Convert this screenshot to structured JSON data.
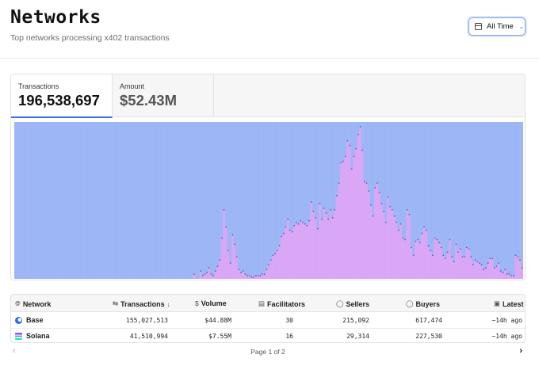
{
  "header": {
    "title": "Networks",
    "subtitle": "Top networks processing x402 transactions",
    "range_button": {
      "label": "All Time",
      "icon": "calendar-icon",
      "chevron": "chevron-down-icon"
    }
  },
  "metrics": {
    "tabs": [
      {
        "label": "Transactions",
        "value": "196,538,697",
        "active": true
      },
      {
        "label": "Amount",
        "value": "$52.43M",
        "active": false
      }
    ]
  },
  "chart_data": {
    "type": "bar",
    "stacked": true,
    "normalized": true,
    "title": "",
    "xlabel": "",
    "ylabel": "",
    "ylim": [
      0,
      1
    ],
    "colors": {
      "background_series": "#9db6f5",
      "foreground_series": "#d9a7f6",
      "dot": "#6a5ab8"
    },
    "series": [
      {
        "values": [
          0.0,
          0.0,
          0.0,
          0.0,
          0.0,
          0.0,
          0.0,
          0.0,
          0.0,
          0.0,
          0.0,
          0.0,
          0.0,
          0.0,
          0.0,
          0.0,
          0.0,
          0.0,
          0.0,
          0.0,
          0.0,
          0.0,
          0.0,
          0.0,
          0.0,
          0.0,
          0.0,
          0.0,
          0.0,
          0.0,
          0.0,
          0.0,
          0.0,
          0.0,
          0.0,
          0.0,
          0.0,
          0.0,
          0.0,
          0.0,
          0.0,
          0.0,
          0.0,
          0.0,
          0.0,
          0.0,
          0.0,
          0.0,
          0.0,
          0.0,
          0.0,
          0.0,
          0.0,
          0.0,
          0.0,
          0.0,
          0.0,
          0.0,
          0.0,
          0.0,
          0.0,
          0.0,
          0.0,
          0.0,
          0.0,
          0.0,
          0.0,
          0.0,
          0.0,
          0.0,
          0.0,
          0.0,
          0.0,
          0.0,
          0.0,
          0.0,
          0.0,
          0.0,
          0.0,
          0.0,
          0.0,
          0.0,
          0.0,
          0.0,
          0.03,
          0.0,
          0.0,
          0.05,
          0.02,
          0.03,
          0.04,
          0.07,
          0.03,
          0.02,
          0.05,
          0.08,
          0.12,
          0.26,
          0.44,
          0.33,
          0.18,
          0.1,
          0.28,
          0.22,
          0.14,
          0.06,
          0.04,
          0.05,
          0.03,
          0.02,
          0.02,
          0.01,
          0.01,
          0.02,
          0.02,
          0.02,
          0.03,
          0.03,
          0.06,
          0.09,
          0.12,
          0.15,
          0.16,
          0.18,
          0.21,
          0.27,
          0.29,
          0.33,
          0.38,
          0.31,
          0.3,
          0.34,
          0.36,
          0.35,
          0.37,
          0.36,
          0.35,
          0.34,
          0.37,
          0.49,
          0.43,
          0.39,
          0.32,
          0.48,
          0.38,
          0.45,
          0.42,
          0.38,
          0.44,
          0.39,
          0.44,
          0.53,
          0.61,
          0.74,
          0.75,
          0.78,
          0.88,
          0.85,
          0.7,
          0.78,
          0.83,
          0.92,
          0.97,
          0.82,
          0.62,
          0.61,
          0.56,
          0.47,
          0.4,
          0.58,
          0.61,
          0.55,
          0.48,
          0.43,
          0.36,
          0.52,
          0.46,
          0.44,
          0.4,
          0.36,
          0.31,
          0.35,
          0.26,
          0.25,
          0.44,
          0.41,
          0.2,
          0.15,
          0.24,
          0.25,
          0.23,
          0.29,
          0.33,
          0.31,
          0.21,
          0.18,
          0.15,
          0.26,
          0.25,
          0.23,
          0.2,
          0.15,
          0.13,
          0.17,
          0.25,
          0.14,
          0.11,
          0.22,
          0.17,
          0.19,
          0.14,
          0.14,
          0.2,
          0.19,
          0.14,
          0.09,
          0.12,
          0.11,
          0.1,
          0.09,
          0.06,
          0.07,
          0.1,
          0.13,
          0.13,
          0.07,
          0.08,
          0.1,
          0.05,
          0.04,
          0.06,
          0.03,
          0.03,
          0.02,
          0.02,
          0.15,
          0.14,
          0.12,
          0.07
        ]
      },
      {
        "values": [
          1.0,
          1.0,
          1.0,
          1.0,
          1.0,
          1.0,
          1.0,
          1.0,
          1.0,
          1.0,
          1.0,
          1.0,
          1.0,
          1.0,
          1.0,
          1.0,
          1.0,
          1.0,
          1.0,
          1.0,
          1.0,
          1.0,
          1.0,
          1.0,
          1.0,
          1.0,
          1.0,
          1.0,
          1.0,
          1.0,
          1.0,
          1.0,
          1.0,
          1.0,
          1.0,
          1.0,
          1.0,
          1.0,
          1.0,
          1.0,
          1.0,
          1.0,
          1.0,
          1.0,
          1.0,
          1.0,
          1.0,
          1.0,
          1.0,
          1.0,
          1.0,
          1.0,
          1.0,
          1.0,
          1.0,
          1.0,
          1.0,
          1.0,
          1.0,
          1.0,
          1.0,
          1.0,
          1.0,
          1.0,
          1.0,
          1.0,
          1.0,
          1.0,
          1.0,
          1.0,
          1.0,
          1.0,
          1.0,
          1.0,
          1.0,
          1.0,
          1.0,
          1.0,
          1.0,
          1.0,
          1.0,
          1.0,
          1.0,
          1.0,
          0.97,
          1.0,
          1.0,
          0.95,
          0.98,
          0.97,
          0.96,
          0.93,
          0.97,
          0.98,
          0.95,
          0.92,
          0.88,
          0.74,
          0.56,
          0.67,
          0.82,
          0.9,
          0.72,
          0.78,
          0.86,
          0.94,
          0.96,
          0.95,
          0.97,
          0.98,
          0.98,
          0.99,
          0.99,
          0.98,
          0.98,
          0.98,
          0.97,
          0.97,
          0.94,
          0.91,
          0.88,
          0.85,
          0.84,
          0.82,
          0.79,
          0.73,
          0.71,
          0.67,
          0.62,
          0.69,
          0.7,
          0.66,
          0.64,
          0.65,
          0.63,
          0.64,
          0.65,
          0.66,
          0.63,
          0.51,
          0.57,
          0.61,
          0.68,
          0.52,
          0.62,
          0.55,
          0.58,
          0.62,
          0.56,
          0.61,
          0.56,
          0.47,
          0.39,
          0.26,
          0.25,
          0.22,
          0.12,
          0.15,
          0.3,
          0.22,
          0.17,
          0.08,
          0.03,
          0.18,
          0.38,
          0.39,
          0.44,
          0.53,
          0.6,
          0.42,
          0.39,
          0.45,
          0.52,
          0.57,
          0.64,
          0.48,
          0.54,
          0.56,
          0.6,
          0.64,
          0.69,
          0.65,
          0.74,
          0.75,
          0.56,
          0.59,
          0.8,
          0.85,
          0.76,
          0.75,
          0.77,
          0.71,
          0.67,
          0.69,
          0.79,
          0.82,
          0.85,
          0.74,
          0.75,
          0.77,
          0.8,
          0.85,
          0.87,
          0.83,
          0.75,
          0.86,
          0.89,
          0.78,
          0.83,
          0.81,
          0.86,
          0.86,
          0.8,
          0.81,
          0.86,
          0.91,
          0.88,
          0.89,
          0.9,
          0.91,
          0.94,
          0.93,
          0.9,
          0.87,
          0.87,
          0.93,
          0.92,
          0.9,
          0.95,
          0.96,
          0.94,
          0.97,
          0.97,
          0.98,
          0.98,
          0.85,
          0.86,
          0.88,
          0.93
        ]
      }
    ]
  },
  "table": {
    "columns": [
      {
        "label": "Network",
        "icon": "globe-icon"
      },
      {
        "label": "Transactions",
        "icon": "arrows-exchange-icon",
        "sort": "↓"
      },
      {
        "label": "Volume",
        "icon": "dollar-icon"
      },
      {
        "label": "Facilitators",
        "icon": "server-icon"
      },
      {
        "label": "Sellers",
        "icon": "user-icon"
      },
      {
        "label": "Buyers",
        "icon": "user-icon"
      },
      {
        "label": "Latest",
        "icon": "calendar-icon"
      }
    ],
    "rows": [
      {
        "network": "Base",
        "icon": "base-logo-icon",
        "transactions": "155,027,513",
        "volume": "$44.88M",
        "facilitators": "30",
        "sellers": "215,092",
        "buyers": "617,474",
        "latest": "~14h ago"
      },
      {
        "network": "Solana",
        "icon": "solana-logo-icon",
        "transactions": "41,510,994",
        "volume": "$7.55M",
        "facilitators": "16",
        "sellers": "29,314",
        "buyers": "227,530",
        "latest": "~14h ago"
      }
    ]
  },
  "pagination": {
    "info": "Page 1 of 2",
    "prev_icon": "chevron-left-icon",
    "next_icon": "chevron-right-icon"
  }
}
